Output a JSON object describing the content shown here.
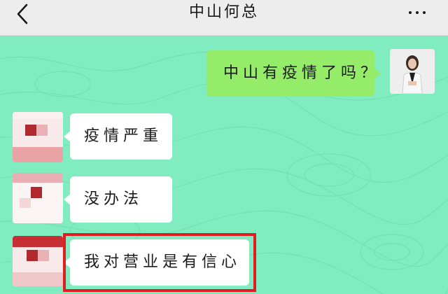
{
  "header": {
    "title": "中山何总"
  },
  "messages": [
    {
      "sender": "me",
      "text": "中山有疫情了吗？"
    },
    {
      "sender": "other",
      "text": "疫情严重"
    },
    {
      "sender": "other",
      "text": "没办法"
    },
    {
      "sender": "other",
      "text": "我对营业是有信心",
      "highlighted": true
    }
  ],
  "colors": {
    "chat_background": "#80ecc0",
    "header_background": "#ededed",
    "my_bubble": "#95ec69",
    "their_bubble": "#ffffff",
    "highlight_border": "#e11d23"
  },
  "icons": {
    "back": "chevron-left-icon",
    "more": "more-dots-icon"
  }
}
